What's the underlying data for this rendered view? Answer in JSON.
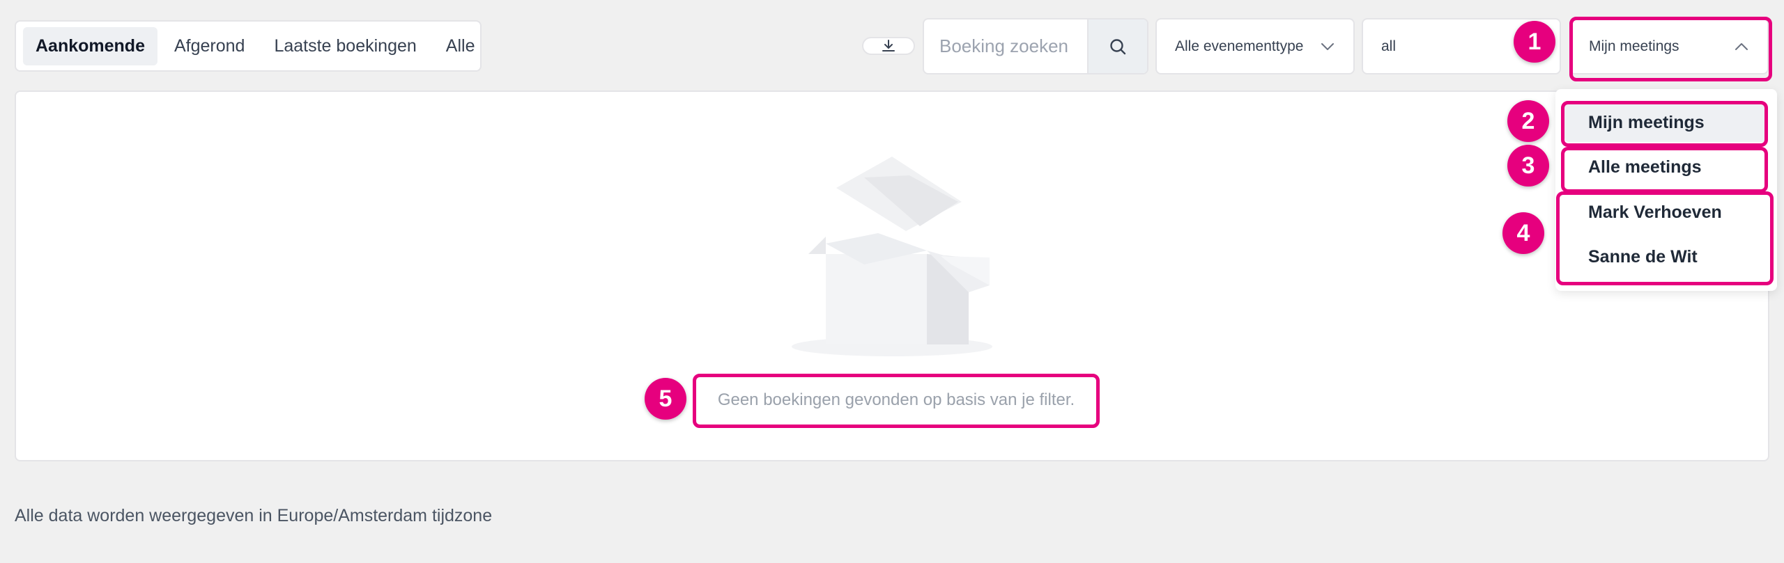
{
  "tabs": [
    {
      "label": "Aankomende",
      "active": true
    },
    {
      "label": "Afgerond",
      "active": false
    },
    {
      "label": "Laatste boekingen",
      "active": false
    },
    {
      "label": "Alle",
      "active": false
    }
  ],
  "toolbar": {
    "download_icon": "download-icon",
    "search_placeholder": "Boeking zoeken",
    "search_icon": "search-icon",
    "event_type_select": "Alle evenementtype",
    "status_select": "all",
    "meetings_select": "Mijn meetings"
  },
  "dropdown": {
    "items": [
      {
        "label": "Mijn meetings",
        "selected": true
      },
      {
        "label": "Alle meetings",
        "selected": false
      },
      {
        "label": "Mark Verhoeven",
        "selected": false
      },
      {
        "label": "Sanne de Wit",
        "selected": false
      }
    ]
  },
  "empty_state": {
    "illustration": "open-box-icon",
    "message": "Geen boekingen gevonden op basis van je filter."
  },
  "footer": {
    "timezone_note": "Alle data worden weergegeven in Europe/Amsterdam tijdzone"
  },
  "annotations": {
    "badges": [
      "1",
      "2",
      "3",
      "4",
      "5"
    ],
    "color": "#e6007e"
  }
}
